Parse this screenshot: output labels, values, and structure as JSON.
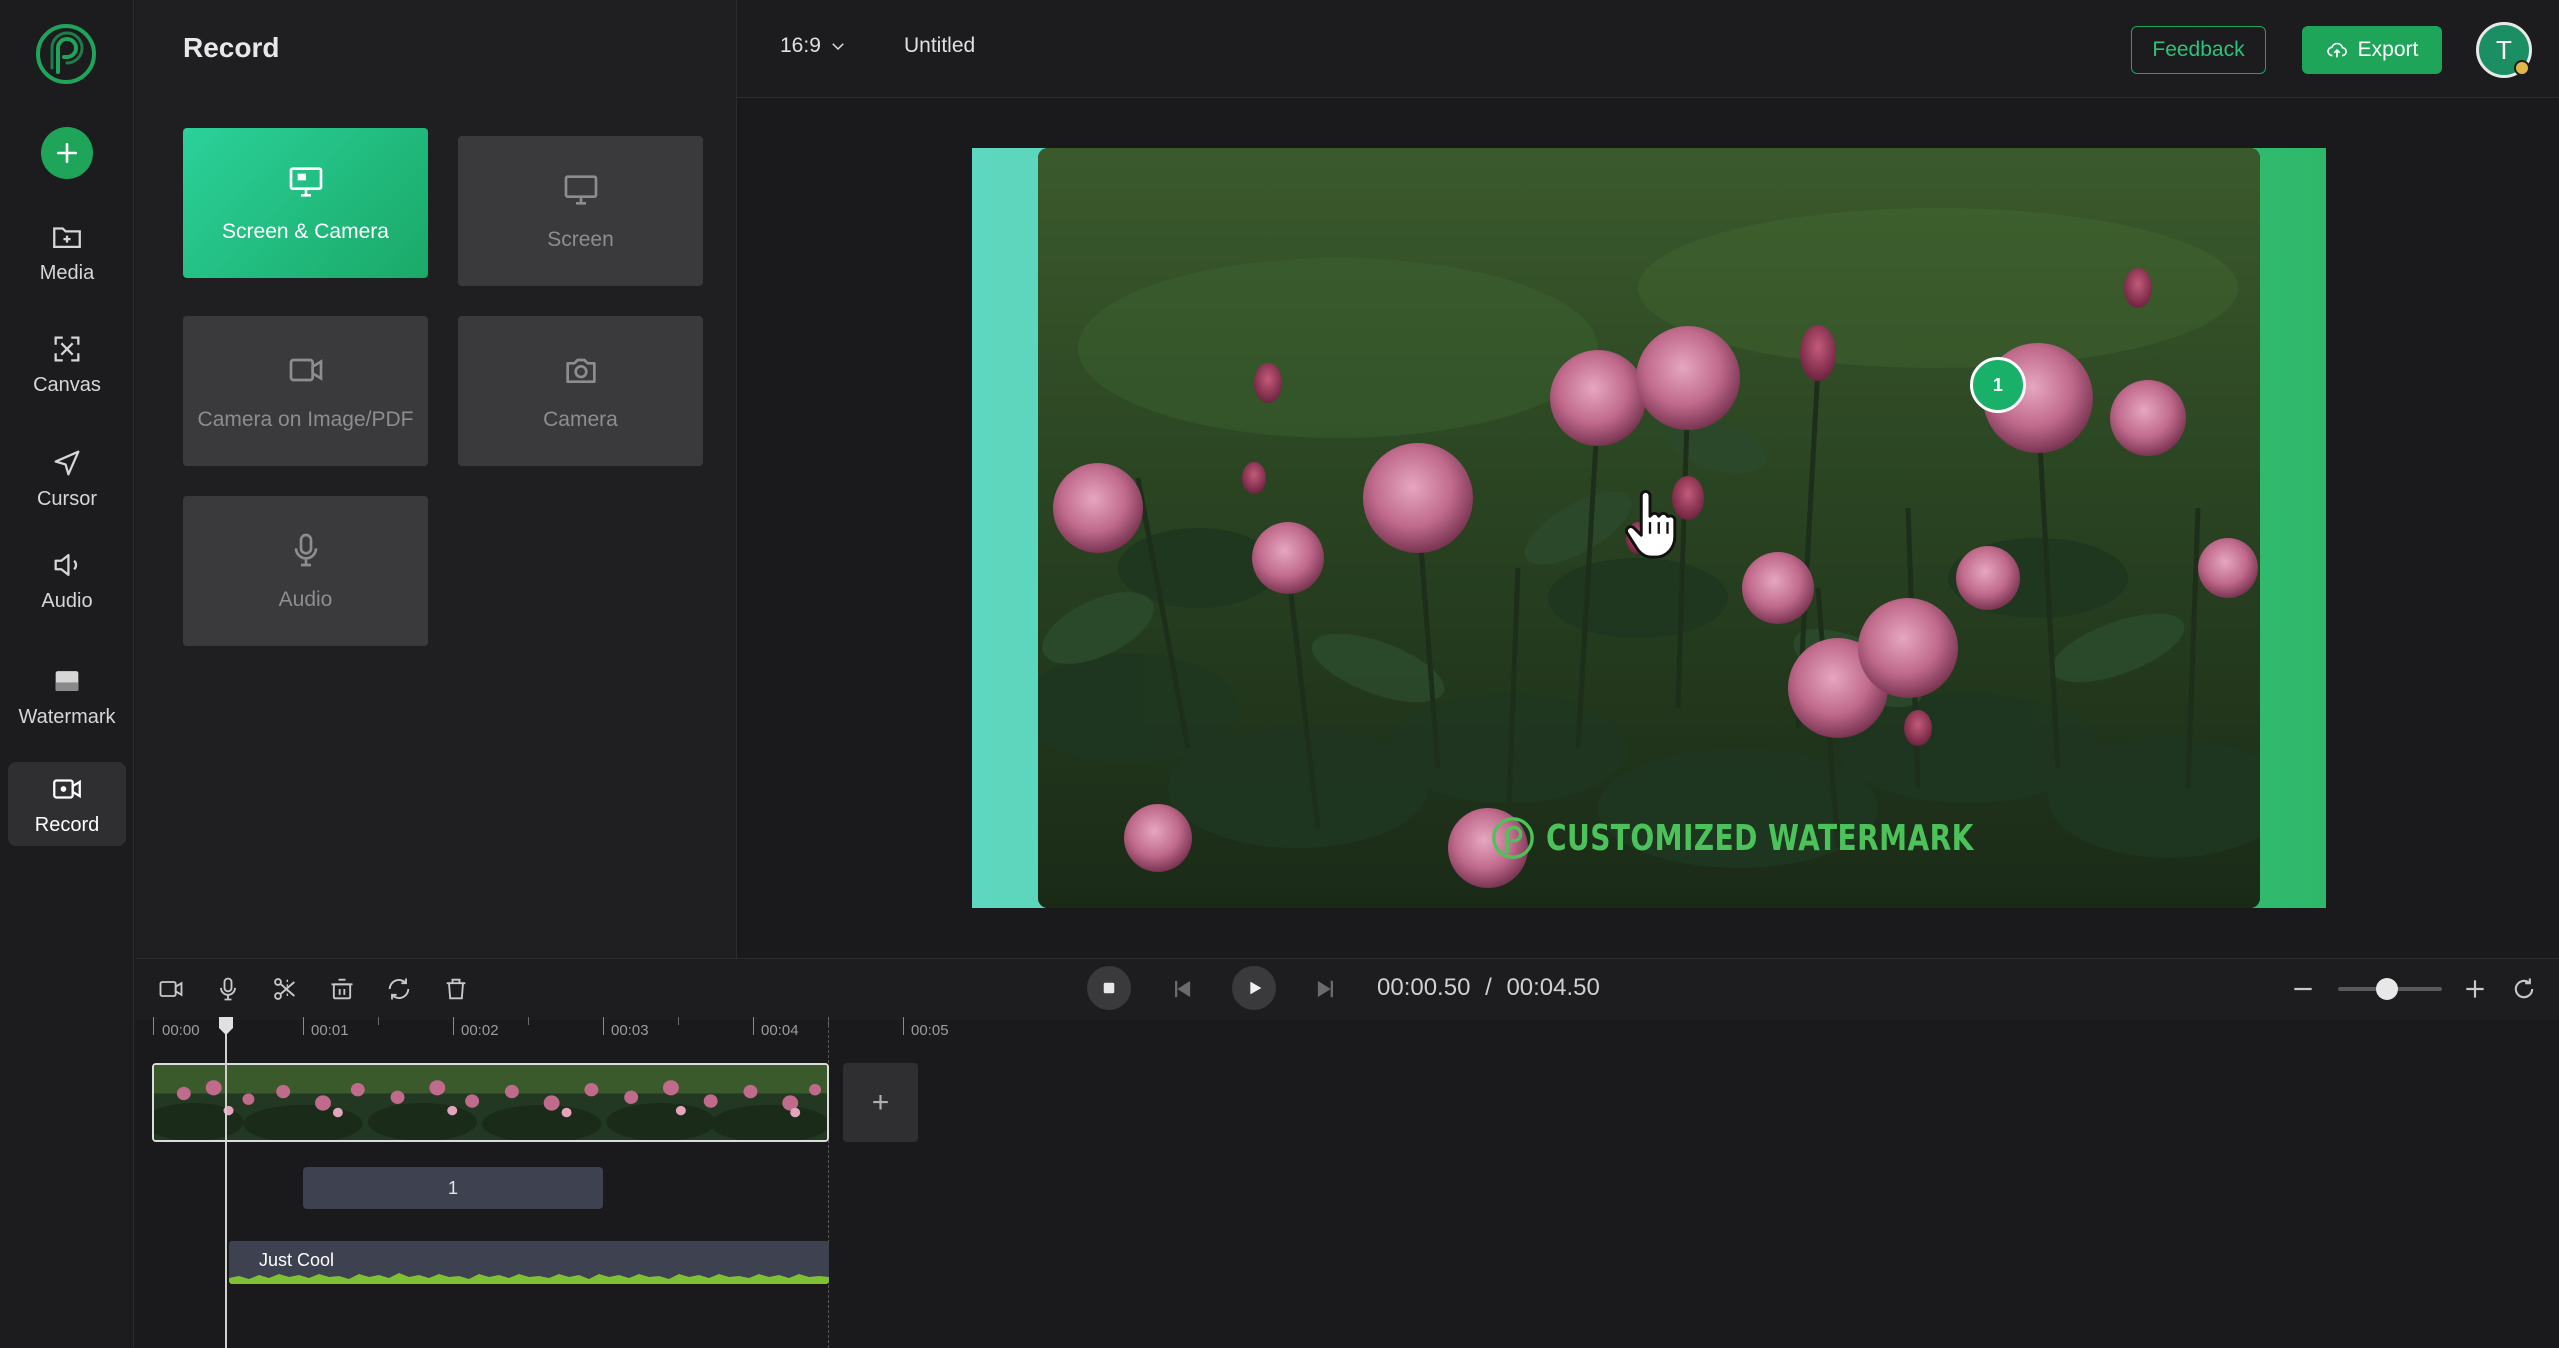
{
  "sidebar": {
    "items": [
      {
        "label": "Media",
        "icon": "media-folder-icon"
      },
      {
        "label": "Canvas",
        "icon": "canvas-expand-icon"
      },
      {
        "label": "Cursor",
        "icon": "cursor-arrow-icon"
      },
      {
        "label": "Audio",
        "icon": "speaker-icon"
      },
      {
        "label": "Watermark",
        "icon": "watermark-icon"
      },
      {
        "label": "Record",
        "icon": "record-camera-icon"
      }
    ],
    "active": "Record"
  },
  "panel": {
    "title": "Record",
    "options": [
      {
        "label": "Screen & Camera",
        "icon": "screen-camera-icon",
        "active": true
      },
      {
        "label": "Screen",
        "icon": "monitor-icon",
        "active": false
      },
      {
        "label": "Camera on Image/PDF",
        "icon": "video-camera-icon",
        "active": false
      },
      {
        "label": "Camera",
        "icon": "photo-camera-icon",
        "active": false
      },
      {
        "label": "Audio",
        "icon": "microphone-icon",
        "active": false
      }
    ]
  },
  "header": {
    "aspect_ratio": "16:9",
    "title": "Untitled",
    "feedback_label": "Feedback",
    "export_label": "Export",
    "avatar_initial": "T"
  },
  "preview": {
    "click_marker": "1",
    "watermark_text": "CUSTOMIZED WATERMARK"
  },
  "player": {
    "current_time": "00:00.50",
    "separator": "/",
    "total_time": "00:04.50"
  },
  "timeline": {
    "ticks": [
      "00:00",
      "00:01",
      "00:02",
      "00:03",
      "00:04",
      "00:05"
    ],
    "marker_clip_label": "1",
    "audio_clip_label": "Just Cool",
    "add_label": "+"
  },
  "colors": {
    "accent": "#1ea55a",
    "background": "#1a1a1c",
    "panel": "#1f1f21",
    "canvas_gradient_start": "#5fd7c0",
    "canvas_gradient_end": "#2fb86a"
  }
}
